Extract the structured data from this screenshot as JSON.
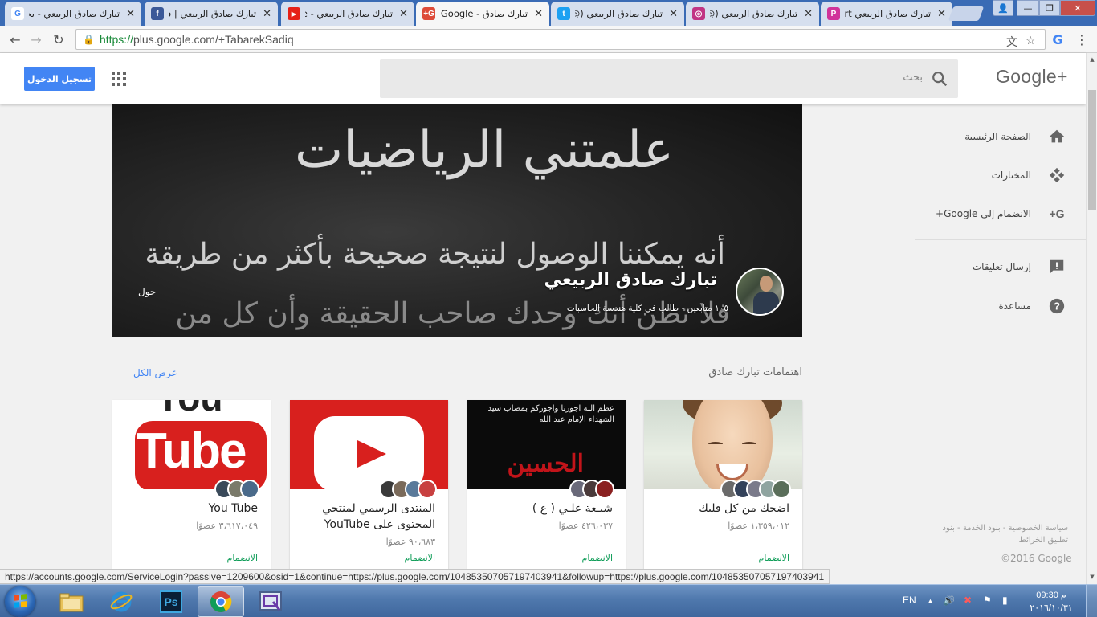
{
  "browser": {
    "tabs": [
      {
        "title": "تبارك صادق الربيعي - بحث",
        "icon": "google-icon"
      },
      {
        "title": "تبارك صادق الربيعي | فيسبوك",
        "icon": "facebook-icon"
      },
      {
        "title": "تبارك صادق الربيعي - YouTube",
        "icon": "youtube-icon"
      },
      {
        "title": "تبارك صادق - Google+",
        "icon": "google-plus-icon",
        "active": true
      },
      {
        "title": "تبارك صادق الربيعي (@",
        "icon": "twitter-icon"
      },
      {
        "title": "تبارك صادق الربيعي (@",
        "icon": "instagram-icon"
      },
      {
        "title": "تبارك صادق الربيعي Art",
        "icon": "picsart-icon"
      }
    ],
    "url_scheme": "https://",
    "url_rest": "plus.google.com/+TabarekSadiq",
    "window_buttons": {
      "user": "👤",
      "minimize": "—",
      "restore": "❐",
      "close": "✕"
    }
  },
  "header": {
    "sign_in": "تسجيل الدخول",
    "search_placeholder": "بحث",
    "logo": "Google+"
  },
  "cover": {
    "line1": "علمتني الرياضيات",
    "line2": "أنه يمكننا الوصول لنتيجة صحيحة بأكثر من طريقة",
    "line3": "فلا تظن أنك وحدك صاحب الحقيقة وأن كل من",
    "profile_name": "تبارك صادق الربيعي",
    "profile_meta": "١٠٥ متابعين - طالب في كلية هندسة الحاسبات",
    "about": "حول"
  },
  "sidebar": {
    "items": [
      {
        "label": "الصفحة الرئيسية",
        "icon": "home-icon"
      },
      {
        "label": "المختارات",
        "icon": "collections-icon"
      },
      {
        "label": "الانضمام إلى Google+",
        "icon": "google-plus-join-icon"
      },
      {
        "label": "إرسال تعليقات",
        "icon": "feedback-icon"
      },
      {
        "label": "مساعدة",
        "icon": "help-icon"
      }
    ],
    "footer": "سياسة الخصوصية - بنود الخدمة - بنود تطبيق الخرائط",
    "copyright": "©2016 Google"
  },
  "interests": {
    "title": "اهتمامات تبارك صادق",
    "see_all": "عرض الكل",
    "cards": [
      {
        "title": "اضحك من كل قلبك",
        "members": "١،٣٥٩،٠١٢ عضوًا",
        "join": "الانضمام"
      },
      {
        "title": "شيـعة علـي ( ع )",
        "members": "٤٢٦،٠٣٧ عضوًا",
        "join": "الانضمام",
        "thumb_text": "عظم الله اجورنا واجوركم بمصاب سيد الشهداء الإمام عبد الله",
        "thumb_title": "الحسين"
      },
      {
        "title": "المنتدى الرسمي لمنتجي المحتوى على YouTube",
        "members": "٩٠،٦٨٣ عضوًا",
        "join": "الانضمام"
      },
      {
        "title": "You Tube",
        "members": "٣،٦١٧،٠٤٩ عضوًا",
        "join": "الانضمام",
        "thumb_you": "You",
        "thumb_tube": "Tube"
      }
    ]
  },
  "status_url": "https://accounts.google.com/ServiceLogin?passive=1209600&osid=1&continue=https://plus.google.com/104853507057197403941&followup=https://plus.google.com/104853507057197403941",
  "taskbar": {
    "language": "EN",
    "time": "09:30 م",
    "date": "٢٠١٦/١٠/٣١",
    "apps": [
      {
        "name": "file-explorer-icon"
      },
      {
        "name": "internet-explorer-icon"
      },
      {
        "name": "photoshop-icon",
        "label": "Ps"
      },
      {
        "name": "chrome-icon"
      },
      {
        "name": "screen-capture-icon"
      }
    ]
  },
  "colors": {
    "accent": "#4285f4",
    "join": "#0f9d58",
    "youtube_red": "#d8201e",
    "tabstrip": "#3a6bb5"
  }
}
